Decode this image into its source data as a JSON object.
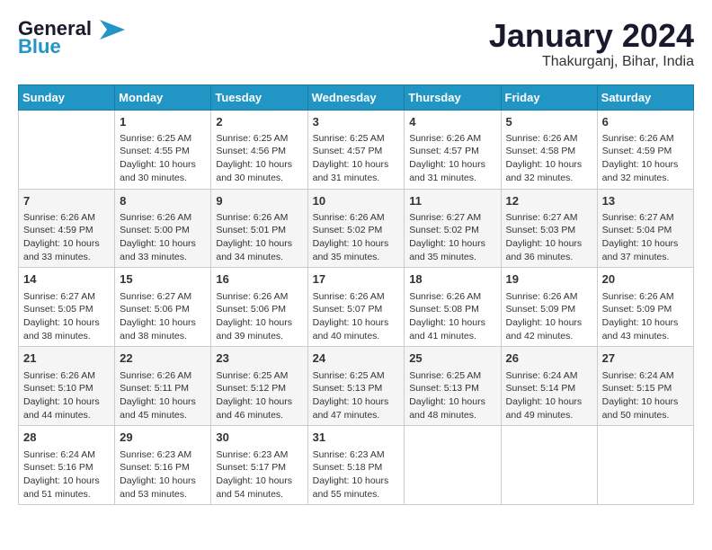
{
  "header": {
    "logo_line1": "General",
    "logo_line2": "Blue",
    "month": "January 2024",
    "location": "Thakurganj, Bihar, India"
  },
  "days_of_week": [
    "Sunday",
    "Monday",
    "Tuesday",
    "Wednesday",
    "Thursday",
    "Friday",
    "Saturday"
  ],
  "weeks": [
    [
      {
        "day": "",
        "info": ""
      },
      {
        "day": "1",
        "info": "Sunrise: 6:25 AM\nSunset: 4:55 PM\nDaylight: 10 hours\nand 30 minutes."
      },
      {
        "day": "2",
        "info": "Sunrise: 6:25 AM\nSunset: 4:56 PM\nDaylight: 10 hours\nand 30 minutes."
      },
      {
        "day": "3",
        "info": "Sunrise: 6:25 AM\nSunset: 4:57 PM\nDaylight: 10 hours\nand 31 minutes."
      },
      {
        "day": "4",
        "info": "Sunrise: 6:26 AM\nSunset: 4:57 PM\nDaylight: 10 hours\nand 31 minutes."
      },
      {
        "day": "5",
        "info": "Sunrise: 6:26 AM\nSunset: 4:58 PM\nDaylight: 10 hours\nand 32 minutes."
      },
      {
        "day": "6",
        "info": "Sunrise: 6:26 AM\nSunset: 4:59 PM\nDaylight: 10 hours\nand 32 minutes."
      }
    ],
    [
      {
        "day": "7",
        "info": "Sunrise: 6:26 AM\nSunset: 4:59 PM\nDaylight: 10 hours\nand 33 minutes."
      },
      {
        "day": "8",
        "info": "Sunrise: 6:26 AM\nSunset: 5:00 PM\nDaylight: 10 hours\nand 33 minutes."
      },
      {
        "day": "9",
        "info": "Sunrise: 6:26 AM\nSunset: 5:01 PM\nDaylight: 10 hours\nand 34 minutes."
      },
      {
        "day": "10",
        "info": "Sunrise: 6:26 AM\nSunset: 5:02 PM\nDaylight: 10 hours\nand 35 minutes."
      },
      {
        "day": "11",
        "info": "Sunrise: 6:27 AM\nSunset: 5:02 PM\nDaylight: 10 hours\nand 35 minutes."
      },
      {
        "day": "12",
        "info": "Sunrise: 6:27 AM\nSunset: 5:03 PM\nDaylight: 10 hours\nand 36 minutes."
      },
      {
        "day": "13",
        "info": "Sunrise: 6:27 AM\nSunset: 5:04 PM\nDaylight: 10 hours\nand 37 minutes."
      }
    ],
    [
      {
        "day": "14",
        "info": "Sunrise: 6:27 AM\nSunset: 5:05 PM\nDaylight: 10 hours\nand 38 minutes."
      },
      {
        "day": "15",
        "info": "Sunrise: 6:27 AM\nSunset: 5:06 PM\nDaylight: 10 hours\nand 38 minutes."
      },
      {
        "day": "16",
        "info": "Sunrise: 6:26 AM\nSunset: 5:06 PM\nDaylight: 10 hours\nand 39 minutes."
      },
      {
        "day": "17",
        "info": "Sunrise: 6:26 AM\nSunset: 5:07 PM\nDaylight: 10 hours\nand 40 minutes."
      },
      {
        "day": "18",
        "info": "Sunrise: 6:26 AM\nSunset: 5:08 PM\nDaylight: 10 hours\nand 41 minutes."
      },
      {
        "day": "19",
        "info": "Sunrise: 6:26 AM\nSunset: 5:09 PM\nDaylight: 10 hours\nand 42 minutes."
      },
      {
        "day": "20",
        "info": "Sunrise: 6:26 AM\nSunset: 5:09 PM\nDaylight: 10 hours\nand 43 minutes."
      }
    ],
    [
      {
        "day": "21",
        "info": "Sunrise: 6:26 AM\nSunset: 5:10 PM\nDaylight: 10 hours\nand 44 minutes."
      },
      {
        "day": "22",
        "info": "Sunrise: 6:26 AM\nSunset: 5:11 PM\nDaylight: 10 hours\nand 45 minutes."
      },
      {
        "day": "23",
        "info": "Sunrise: 6:25 AM\nSunset: 5:12 PM\nDaylight: 10 hours\nand 46 minutes."
      },
      {
        "day": "24",
        "info": "Sunrise: 6:25 AM\nSunset: 5:13 PM\nDaylight: 10 hours\nand 47 minutes."
      },
      {
        "day": "25",
        "info": "Sunrise: 6:25 AM\nSunset: 5:13 PM\nDaylight: 10 hours\nand 48 minutes."
      },
      {
        "day": "26",
        "info": "Sunrise: 6:24 AM\nSunset: 5:14 PM\nDaylight: 10 hours\nand 49 minutes."
      },
      {
        "day": "27",
        "info": "Sunrise: 6:24 AM\nSunset: 5:15 PM\nDaylight: 10 hours\nand 50 minutes."
      }
    ],
    [
      {
        "day": "28",
        "info": "Sunrise: 6:24 AM\nSunset: 5:16 PM\nDaylight: 10 hours\nand 51 minutes."
      },
      {
        "day": "29",
        "info": "Sunrise: 6:23 AM\nSunset: 5:16 PM\nDaylight: 10 hours\nand 53 minutes."
      },
      {
        "day": "30",
        "info": "Sunrise: 6:23 AM\nSunset: 5:17 PM\nDaylight: 10 hours\nand 54 minutes."
      },
      {
        "day": "31",
        "info": "Sunrise: 6:23 AM\nSunset: 5:18 PM\nDaylight: 10 hours\nand 55 minutes."
      },
      {
        "day": "",
        "info": ""
      },
      {
        "day": "",
        "info": ""
      },
      {
        "day": "",
        "info": ""
      }
    ]
  ]
}
